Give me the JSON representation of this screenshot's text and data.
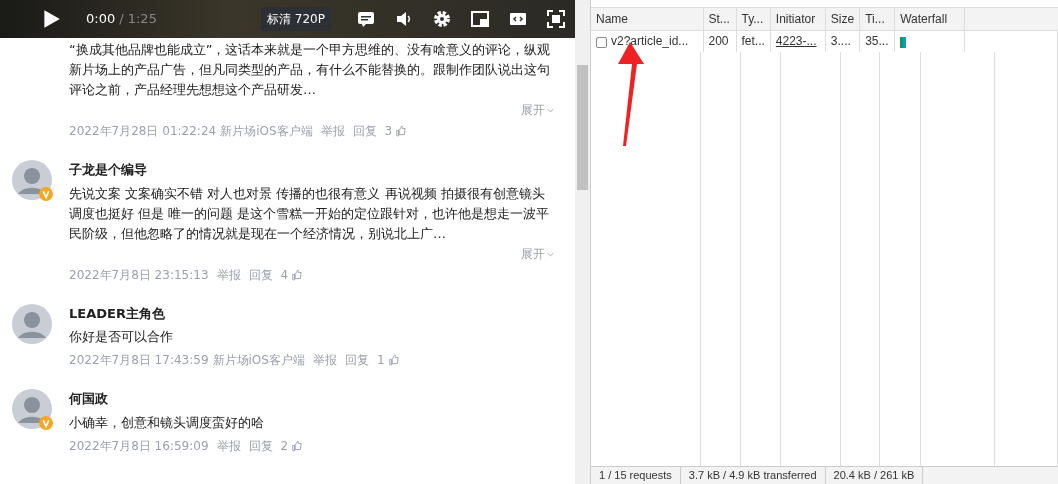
{
  "player": {
    "current_time": "0:00",
    "duration": "/ 1:25",
    "quality": "标清 720P"
  },
  "comments": [
    {
      "avatar": false,
      "text": "“换成其他品牌也能成立”，这话本来就是一个甲方思维的、没有啥意义的评论，纵观新片场上的产品广告，但凡同类型的产品，有什么不能替换的。跟制作团队说出这句评论之前，产品经理先想想这个产品研发…",
      "expand": "展开",
      "date": "2022年7月28日 01:22:24",
      "source": "新片场iOS客户端",
      "report": "举报",
      "reply": "回复",
      "likes": "3"
    },
    {
      "author": "子龙是个编导",
      "avatar": true,
      "verified": true,
      "text": "先说文案 文案确实不错 对人也对景 传播的也很有意义 再说视频 拍摄很有创意镜头调度也挺好 但是 唯一的问题 是这个雪糕一开始的定位跟针对，也许他是想走一波平民阶级，但他忽略了的情况就是现在一个经济情况，别说北上广…",
      "expand": "展开",
      "date": "2022年7月8日 23:15:13",
      "report": "举报",
      "reply": "回复",
      "likes": "4"
    },
    {
      "author": "LEADER主角色",
      "avatar": true,
      "verified": false,
      "text": "你好是否可以合作",
      "date": "2022年7月8日 17:43:59",
      "source": "新片场iOS客户端",
      "report": "举报",
      "reply": "回复",
      "likes": "1"
    },
    {
      "author": "何国政",
      "avatar": true,
      "verified": true,
      "text": "小确幸，创意和镜头调度蛮好的哈",
      "date": "2022年7月8日 16:59:09",
      "report": "举报",
      "reply": "回复",
      "likes": "2"
    }
  ],
  "network": {
    "columns": [
      "Name",
      "St...",
      "Ty...",
      "Initiator",
      "Size",
      "Ti...",
      "Waterfall"
    ],
    "rows": [
      {
        "checked": false,
        "name": "v2?article_id...",
        "status": "200",
        "type": "fet...",
        "initiator": "4223-...",
        "size": "3....",
        "time": "35..."
      }
    ],
    "status_bar": [
      "1 / 15 requests",
      "3.7 kB / 4.9 kB transferred",
      "20.4 kB / 261 kB"
    ]
  }
}
